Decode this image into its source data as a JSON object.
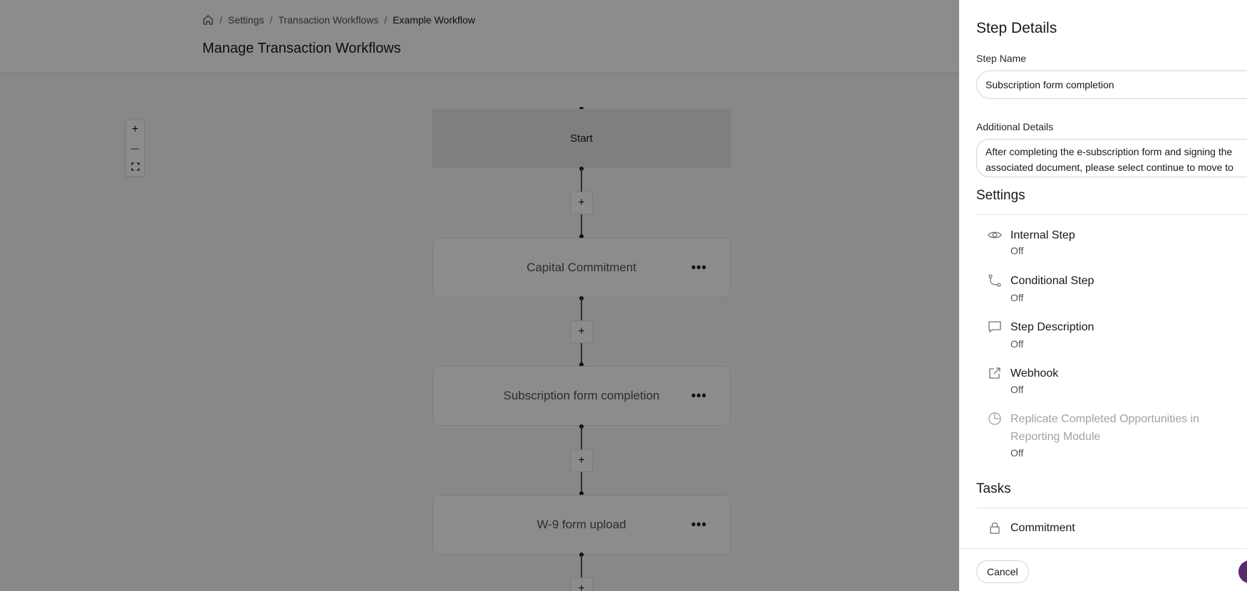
{
  "breadcrumb": {
    "items": [
      "Settings",
      "Transaction Workflows",
      "Example Workflow"
    ]
  },
  "page": {
    "title": "Manage Transaction Workflows"
  },
  "zoom": {
    "zoom_in": "+",
    "zoom_out": "—",
    "fit": "⛶"
  },
  "workflow": {
    "start_label": "Start",
    "add_label": "+",
    "menu_label": "•••",
    "steps": [
      "Capital Commitment",
      "Subscription form completion",
      "W-9 form upload"
    ]
  },
  "panel": {
    "title": "Step Details",
    "step_name_label": "Step Name",
    "step_name_value": "Subscription form completion",
    "additional_details_label": "Additional Details",
    "additional_details_value": "After completing the e-subscription form and signing the\nassociated document, please select continue to move to",
    "settings_title": "Settings",
    "settings": [
      {
        "name": "Internal Step",
        "status": "Off",
        "icon": "eye-icon"
      },
      {
        "name": "Conditional Step",
        "status": "Off",
        "icon": "branch-icon"
      },
      {
        "name": "Step Description",
        "status": "Off",
        "icon": "comment-icon"
      },
      {
        "name": "Webhook",
        "status": "Off",
        "icon": "external-link-icon"
      },
      {
        "name": "Replicate Completed Opportunities in Reporting Module",
        "status": "Off",
        "icon": "pie-chart-icon"
      }
    ],
    "tasks_title": "Tasks",
    "tasks": [
      {
        "name": "Commitment",
        "icon": "lock-icon"
      }
    ],
    "cancel_label": "Cancel"
  },
  "colors": {
    "accent": "#5b2a6e",
    "overlay": "rgba(0,0,0,0.45)"
  }
}
